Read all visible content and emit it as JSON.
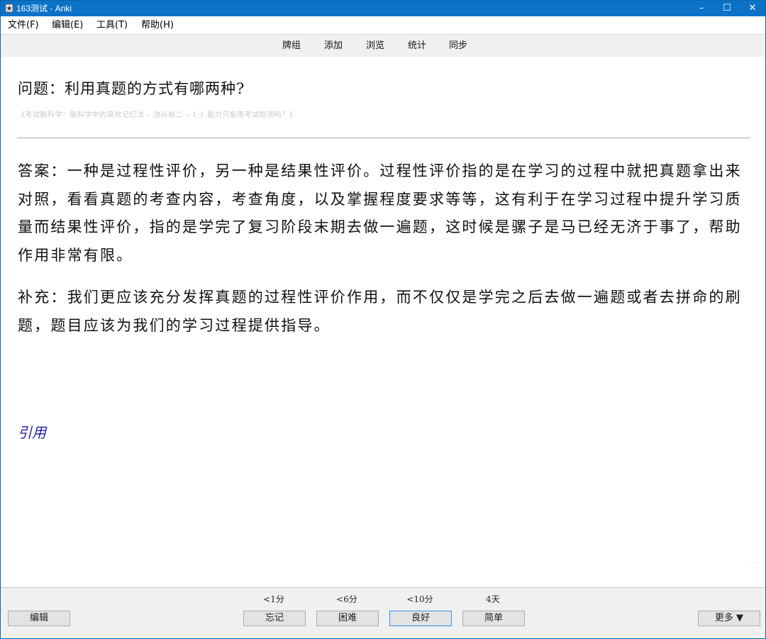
{
  "window": {
    "title": "163测试 - Anki",
    "controls": {
      "minimize": "–",
      "maximize": "☐",
      "close": "✕"
    }
  },
  "menu": [
    "文件(F)",
    "编辑(E)",
    "工具(T)",
    "帮助(H)"
  ],
  "toolbar": [
    "牌组",
    "添加",
    "浏览",
    "统计",
    "同步"
  ],
  "card": {
    "question": "问题：利用真题的方式有哪两种?",
    "source": "《考试脑科学：脑科学中的高效记忆法 – 池谷裕二 – 1·1 能力只能用考试检测吗？》",
    "answer": "答案：一种是过程性评价，另一种是结果性评价。过程性评价指的是在学习的过程中就把真题拿出来对照，看看真题的考查内容，考查角度，以及掌握程度要求等等，这有利于在学习过程中提升学习质量而结果性评价，指的是学完了复习阶段末期去做一遍题，这时候是骡子是马已经无济于事了，帮助作用非常有限。",
    "supplement": "补充：我们更应该充分发挥真题的过程性评价作用，而不仅仅是学完之后去做一遍题或者去拼命的刷题，题目应该为我们的学习过程提供指导。",
    "cite_link": "引用",
    "grip": "....."
  },
  "bottom": {
    "edit_label": "编辑",
    "answers": [
      {
        "interval": "<1分",
        "label": "忘记"
      },
      {
        "interval": "<6分",
        "label": "困难"
      },
      {
        "interval": "<10分",
        "label": "良好"
      },
      {
        "interval": "4天",
        "label": "简单"
      }
    ],
    "more_label": "更多 ▼"
  },
  "colors": {
    "titlebar": "#0b72c8",
    "link": "#2222aa",
    "source_text": "#c8c8c8"
  }
}
